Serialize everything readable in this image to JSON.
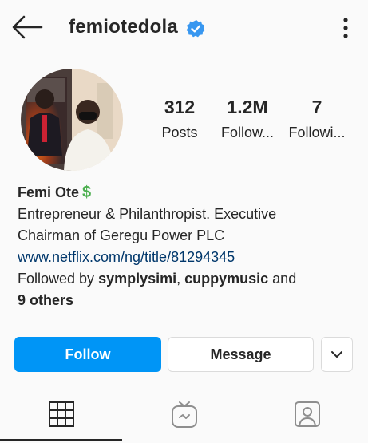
{
  "header": {
    "username": "femiotedola",
    "back_icon": "arrow-left-icon",
    "verified_icon": "verified-badge-icon",
    "more_icon": "more-vertical-icon"
  },
  "stats": [
    {
      "value": "312",
      "label": "Posts"
    },
    {
      "value": "1.2M",
      "label": "Follow..."
    },
    {
      "value": "7",
      "label": "Followi..."
    }
  ],
  "bio": {
    "name": "Femi Ote",
    "name_emoji": "$",
    "line1": "Entrepreneur & Philanthropist. Executive",
    "line2": "Chairman of Geregu Power PLC",
    "link": "www.netflix.com/ng/title/81294345",
    "followed_by_prefix": "Followed by ",
    "follower1": "symplysimi",
    "comma": ", ",
    "follower2": "cuppymusic",
    "and_text": " and",
    "others": "9 others"
  },
  "actions": {
    "follow_label": "Follow",
    "message_label": "Message",
    "more_icon": "chevron-down-icon"
  },
  "tabs": [
    {
      "icon": "grid-icon",
      "active": true
    },
    {
      "icon": "igtv-icon",
      "active": false
    },
    {
      "icon": "tagged-icon",
      "active": false
    }
  ],
  "colors": {
    "accent": "#0095f6",
    "link": "#00376b",
    "verified": "#3897f0",
    "money": "#4caf50"
  }
}
